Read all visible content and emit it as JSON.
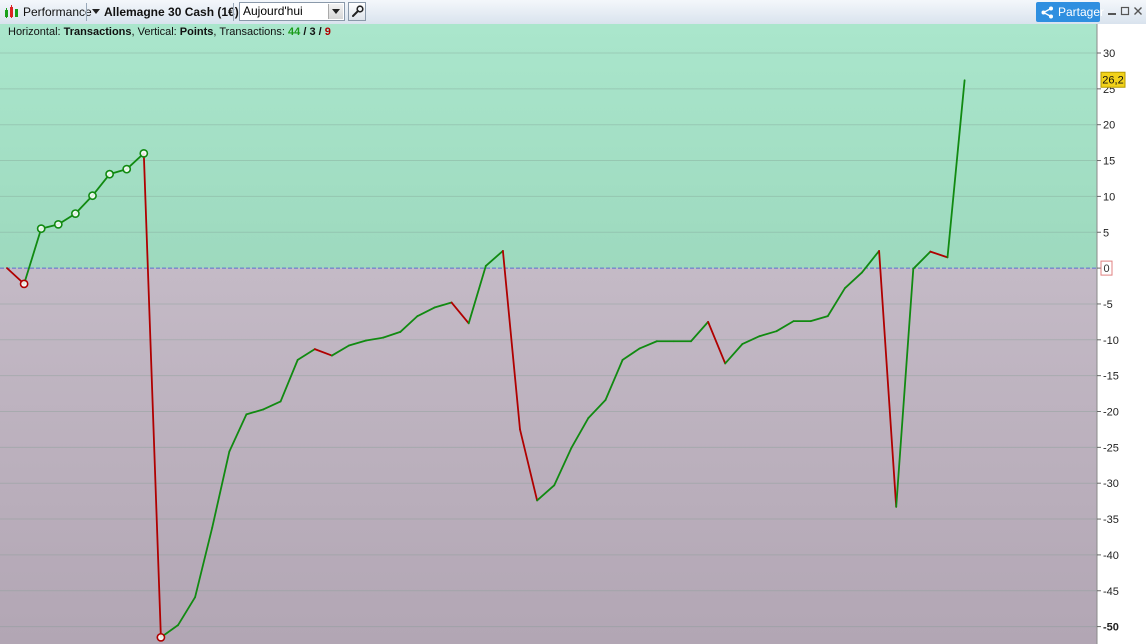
{
  "toolbar": {
    "performance_label": "Performance",
    "instrument_label": "Allemagne 30 Cash (1€)",
    "period_value": "Aujourd'hui",
    "share_label": "Partager"
  },
  "header": {
    "h_prefix": "Horizontal: ",
    "h_value": "Transactions",
    "v_prefix": ", Vertical: ",
    "v_value": "Points",
    "t_prefix": ", Transactions: ",
    "winning": "44",
    "slash1": " / ",
    "neutral": "3",
    "slash2": " / ",
    "losing": "9"
  },
  "colors": {
    "gain_area": "#a6e3c8",
    "loss_area": "#bfb4c0",
    "gain_line": "#118a11",
    "loss_line": "#b00000",
    "zero_line": "#5a6ecf",
    "last_value_badge": "#f2d21a"
  },
  "chart_data": {
    "type": "line",
    "x": [
      0,
      1,
      2,
      3,
      4,
      5,
      6,
      7,
      8,
      9,
      10,
      11,
      12,
      13,
      14,
      15,
      16,
      17,
      18,
      19,
      20,
      21,
      22,
      23,
      24,
      25,
      26,
      27,
      28,
      29,
      30,
      31,
      32,
      33,
      34,
      35,
      36,
      37,
      38,
      39,
      40,
      41,
      42,
      43,
      44,
      45,
      46,
      47,
      48,
      49,
      50,
      51,
      52,
      53,
      54,
      55,
      56,
      57
    ],
    "y": [
      0,
      -2.2,
      5.5,
      6.1,
      7.6,
      10.1,
      13.1,
      13.8,
      16.0,
      -51.5,
      -49.8,
      -45.9,
      -36.2,
      -25.6,
      -20.4,
      -19.7,
      -18.6,
      -12.8,
      -11.3,
      -12.2,
      -10.8,
      -10.1,
      -9.7,
      -8.9,
      -6.7,
      -5.5,
      -4.8,
      -7.7,
      0.3,
      2.4,
      -22.5,
      -32.4,
      -30.3,
      -25.1,
      -20.9,
      -18.4,
      -12.8,
      -11.2,
      -10.2,
      -10.2,
      -10.2,
      -7.5,
      -13.3,
      -10.6,
      -9.5,
      -8.8,
      -7.4,
      -7.4,
      -6.7,
      -2.8,
      -0.6,
      2.4,
      -33.3,
      -0.1,
      2.3,
      1.5,
      26.2
    ],
    "markers": [
      1,
      2,
      3,
      4,
      5,
      6,
      7,
      8,
      9,
      57
    ],
    "yticks": [
      30,
      25,
      20,
      15,
      10,
      5,
      0,
      -5,
      -10,
      -15,
      -20,
      -25,
      -30,
      -35,
      -40,
      -45,
      -50
    ],
    "ylim": [
      -52.5,
      34
    ],
    "zero_label": "0",
    "last_value_label": "26,2",
    "grid": true,
    "xlabel": "Transactions",
    "ylabel": "Points"
  }
}
